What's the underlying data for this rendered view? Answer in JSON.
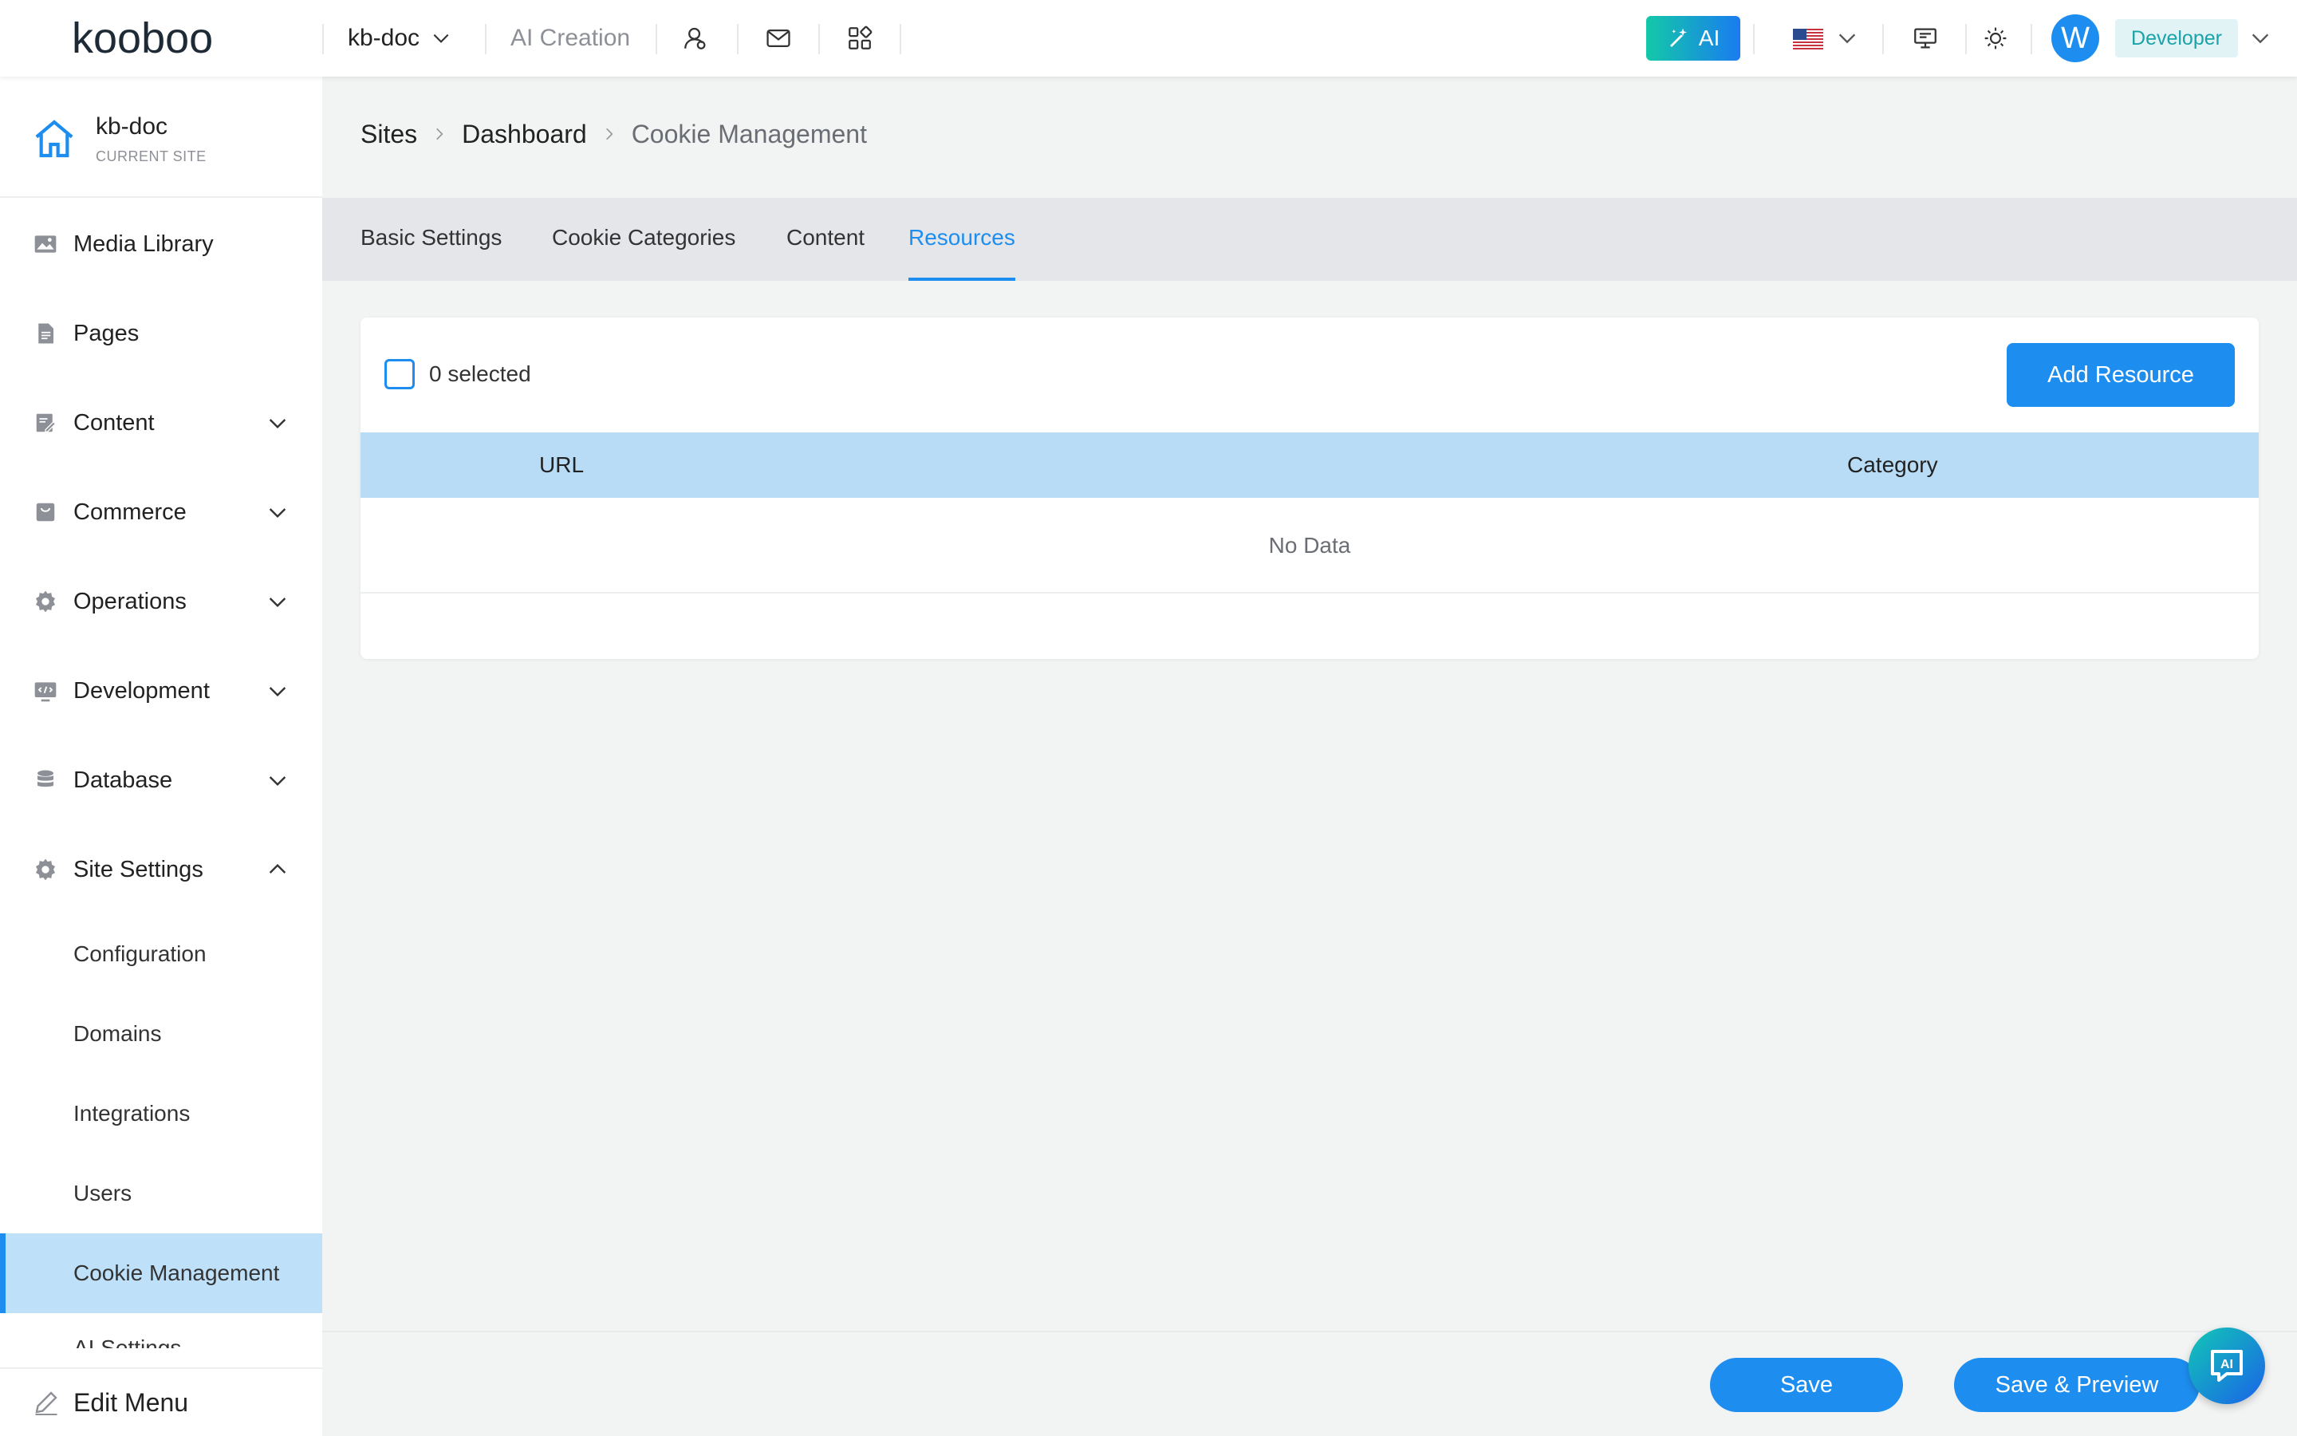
{
  "topbar": {
    "logo_text": "kooboo",
    "site_name": "kb-doc",
    "ai_creation_label": "AI Creation",
    "ai_button_label": "AI",
    "avatar_initial": "W",
    "role_label": "Developer",
    "icons": [
      "users-icon",
      "mail-icon",
      "apps-icon",
      "monitor-icon",
      "sun-icon"
    ],
    "flag": "us-flag-icon"
  },
  "sidebar": {
    "current_site_name": "kb-doc",
    "current_site_sub": "CURRENT SITE",
    "items": [
      {
        "label": "Media Library",
        "icon": "image-icon",
        "expandable": false
      },
      {
        "label": "Pages",
        "icon": "page-icon",
        "expandable": false
      },
      {
        "label": "Content",
        "icon": "edit-doc-icon",
        "expandable": true
      },
      {
        "label": "Commerce",
        "icon": "cart-icon",
        "expandable": true
      },
      {
        "label": "Operations",
        "icon": "gear-icon",
        "expandable": true
      },
      {
        "label": "Development",
        "icon": "code-icon",
        "expandable": true
      },
      {
        "label": "Database",
        "icon": "database-icon",
        "expandable": true
      },
      {
        "label": "Site Settings",
        "icon": "gear-icon",
        "expandable": true,
        "expanded": true
      }
    ],
    "sub_items": [
      {
        "label": "Configuration"
      },
      {
        "label": "Domains"
      },
      {
        "label": "Integrations"
      },
      {
        "label": "Users"
      },
      {
        "label": "Cookie Management",
        "active": true
      }
    ],
    "partial_item": "AI Settings",
    "edit_menu_label": "Edit Menu"
  },
  "breadcrumb": {
    "items": [
      "Sites",
      "Dashboard"
    ],
    "current": "Cookie Management"
  },
  "tabs": [
    {
      "label": "Basic Settings"
    },
    {
      "label": "Cookie Categories"
    },
    {
      "label": "Content"
    },
    {
      "label": "Resources",
      "active": true
    }
  ],
  "table": {
    "selected_text": "0 selected",
    "add_button_label": "Add Resource",
    "columns": [
      "URL",
      "Category"
    ],
    "empty_text": "No Data"
  },
  "footer": {
    "save_label": "Save",
    "save_preview_label": "Save & Preview",
    "ai_fab_label": "AI"
  },
  "colors": {
    "accent": "#1d8ef0",
    "table_header": "#b9dcf6",
    "active_nav": "#bfe0f9"
  }
}
